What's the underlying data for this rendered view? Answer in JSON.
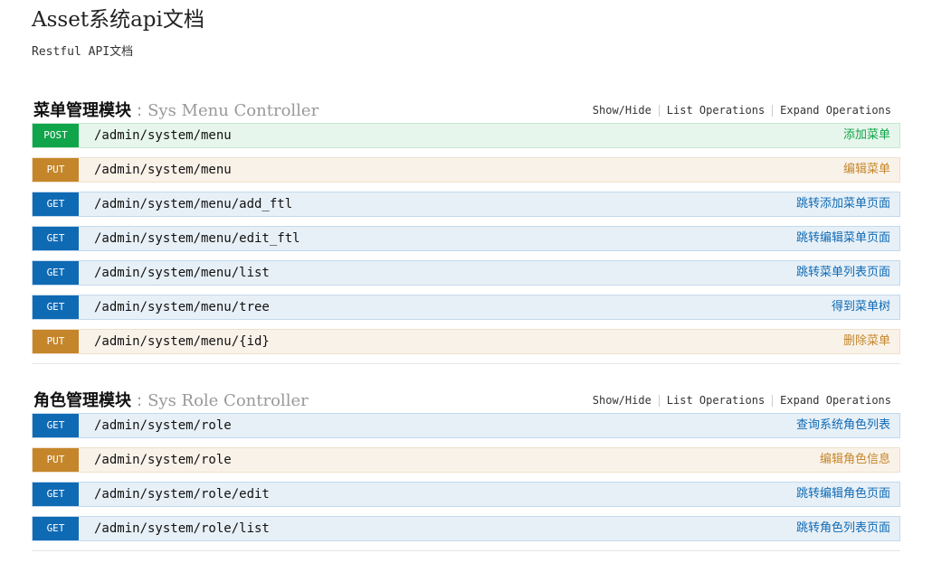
{
  "app": {
    "title": "Asset系统api文档",
    "subtitle": "Restful API文档"
  },
  "resource_links": {
    "show_hide": "Show/Hide",
    "list_ops": "List Operations",
    "expand_ops": "Expand Operations"
  },
  "resources": [
    {
      "name": "菜单管理模块",
      "sep": ":",
      "controller": "Sys Menu Controller",
      "ops": [
        {
          "method": "POST",
          "path": "/admin/system/menu",
          "summary": "添加菜单"
        },
        {
          "method": "PUT",
          "path": "/admin/system/menu",
          "summary": "编辑菜单"
        },
        {
          "method": "GET",
          "path": "/admin/system/menu/add_ftl",
          "summary": "跳转添加菜单页面"
        },
        {
          "method": "GET",
          "path": "/admin/system/menu/edit_ftl",
          "summary": "跳转编辑菜单页面"
        },
        {
          "method": "GET",
          "path": "/admin/system/menu/list",
          "summary": "跳转菜单列表页面"
        },
        {
          "method": "GET",
          "path": "/admin/system/menu/tree",
          "summary": "得到菜单树"
        },
        {
          "method": "PUT",
          "path": "/admin/system/menu/{id}",
          "summary": "删除菜单"
        }
      ]
    },
    {
      "name": "角色管理模块",
      "sep": ":",
      "controller": "Sys Role Controller",
      "ops": [
        {
          "method": "GET",
          "path": "/admin/system/role",
          "summary": "查询系统角色列表"
        },
        {
          "method": "PUT",
          "path": "/admin/system/role",
          "summary": "编辑角色信息"
        },
        {
          "method": "GET",
          "path": "/admin/system/role/edit",
          "summary": "跳转编辑角色页面"
        },
        {
          "method": "GET",
          "path": "/admin/system/role/list",
          "summary": "跳转角色列表页面"
        }
      ]
    }
  ],
  "colors": {
    "post": "#10a54a",
    "put": "#c5862b",
    "get": "#0f6ab4"
  }
}
